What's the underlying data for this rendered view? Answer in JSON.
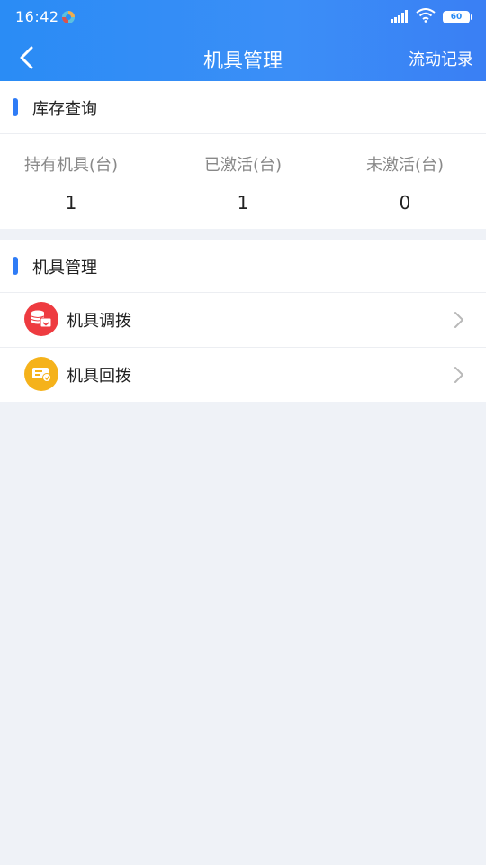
{
  "status": {
    "time": "16:42",
    "battery": "60"
  },
  "nav": {
    "title": "机具管理",
    "right_action": "流动记录"
  },
  "inventory": {
    "section_title": "库存查询",
    "stats": [
      {
        "label": "持有机具(台)",
        "value": "1"
      },
      {
        "label": "已激活(台)",
        "value": "1"
      },
      {
        "label": "未激活(台)",
        "value": "0"
      }
    ]
  },
  "management": {
    "section_title": "机具管理",
    "items": [
      {
        "label": "机具调拨",
        "icon": "transfer-icon",
        "color": "#ee3b40"
      },
      {
        "label": "机具回拨",
        "icon": "return-icon",
        "color": "#f5b21b"
      }
    ]
  },
  "colors": {
    "header": "#2a8cf5",
    "accent": "#2f7cf6",
    "background": "#eff2f7"
  }
}
